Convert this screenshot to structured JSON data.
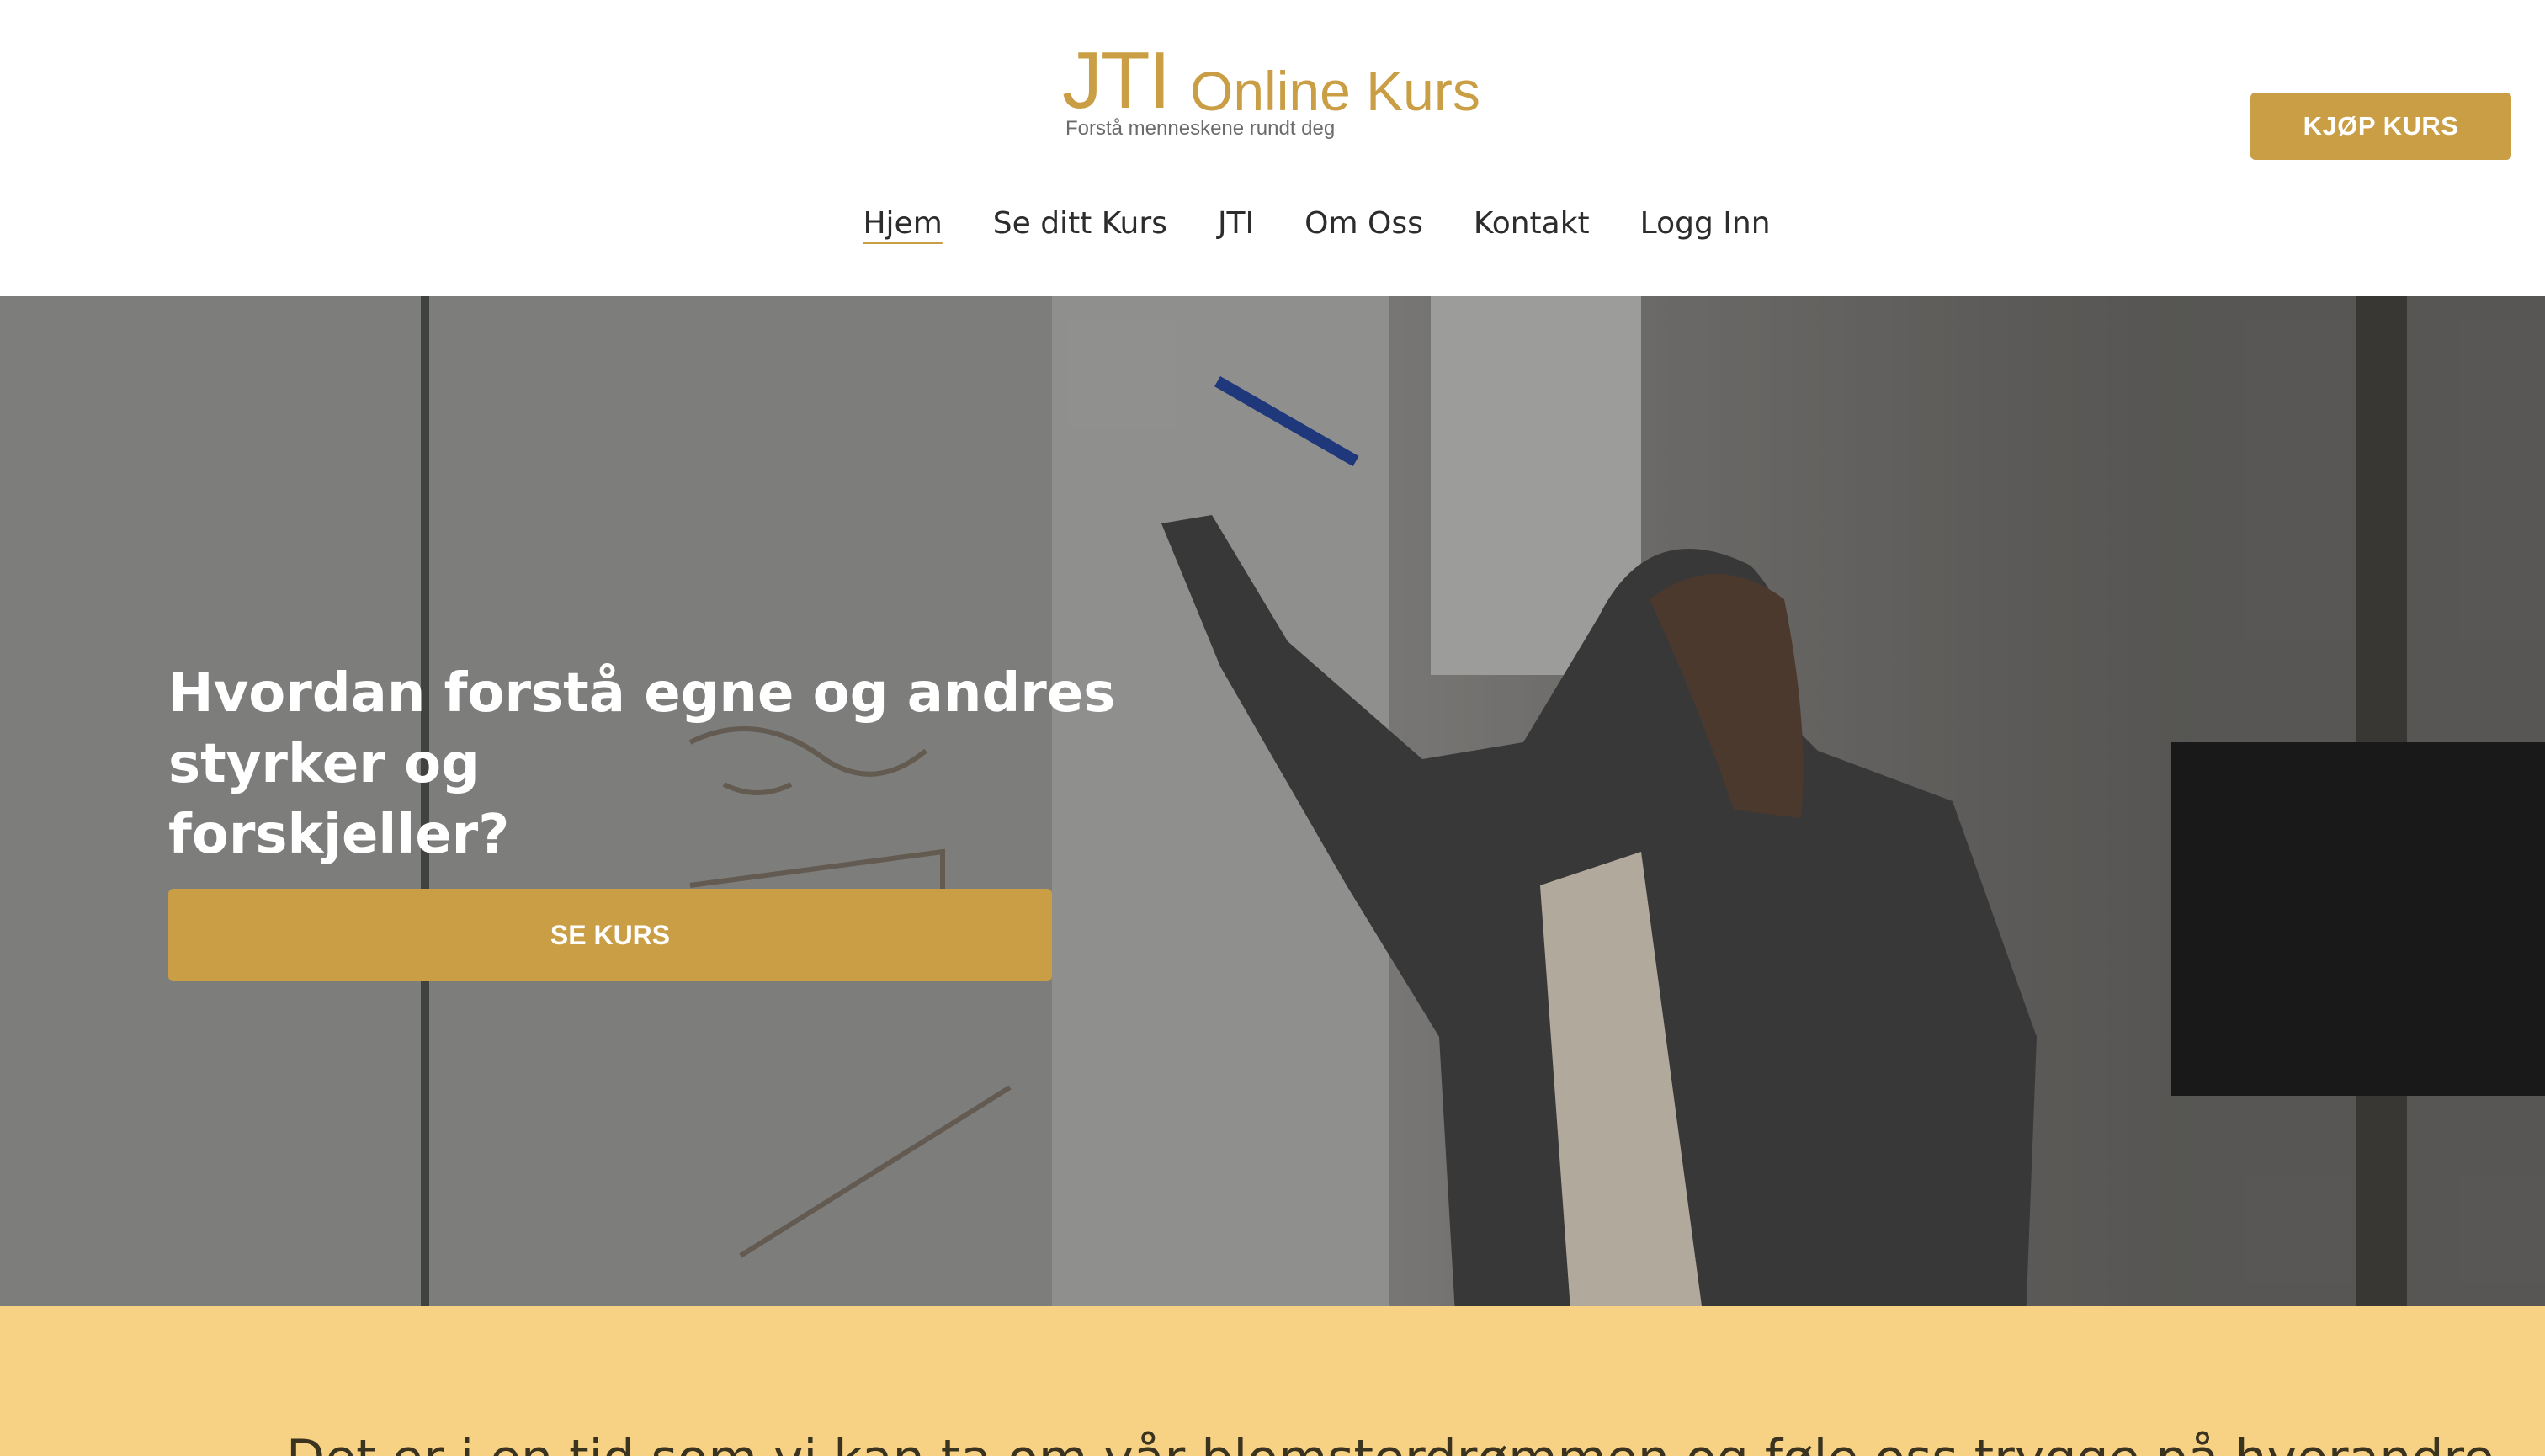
{
  "header": {
    "logo_jti": "JTI",
    "logo_name": "Online Kurs",
    "logo_tagline": "Forstå menneskene rundt deg",
    "buy_button": "KJØP KURS"
  },
  "nav": {
    "items": [
      {
        "label": "Hjem",
        "active": true
      },
      {
        "label": "Se ditt Kurs"
      },
      {
        "label": "JTI"
      },
      {
        "label": "Om Oss"
      },
      {
        "label": "Kontakt"
      },
      {
        "label": "Logg Inn"
      }
    ]
  },
  "hero": {
    "title_line1": "Hvordan forstå egne og andres styrker og",
    "title_line2": "forskjeller?",
    "button": "SE KURS"
  },
  "intro": {
    "text": "Det er i en tid som vi kan ta om vår blomsterdrømmen og føle oss trygge på hverandre."
  },
  "colors": {
    "accent": "#c99e45",
    "intro_bg": "#f7d284"
  }
}
